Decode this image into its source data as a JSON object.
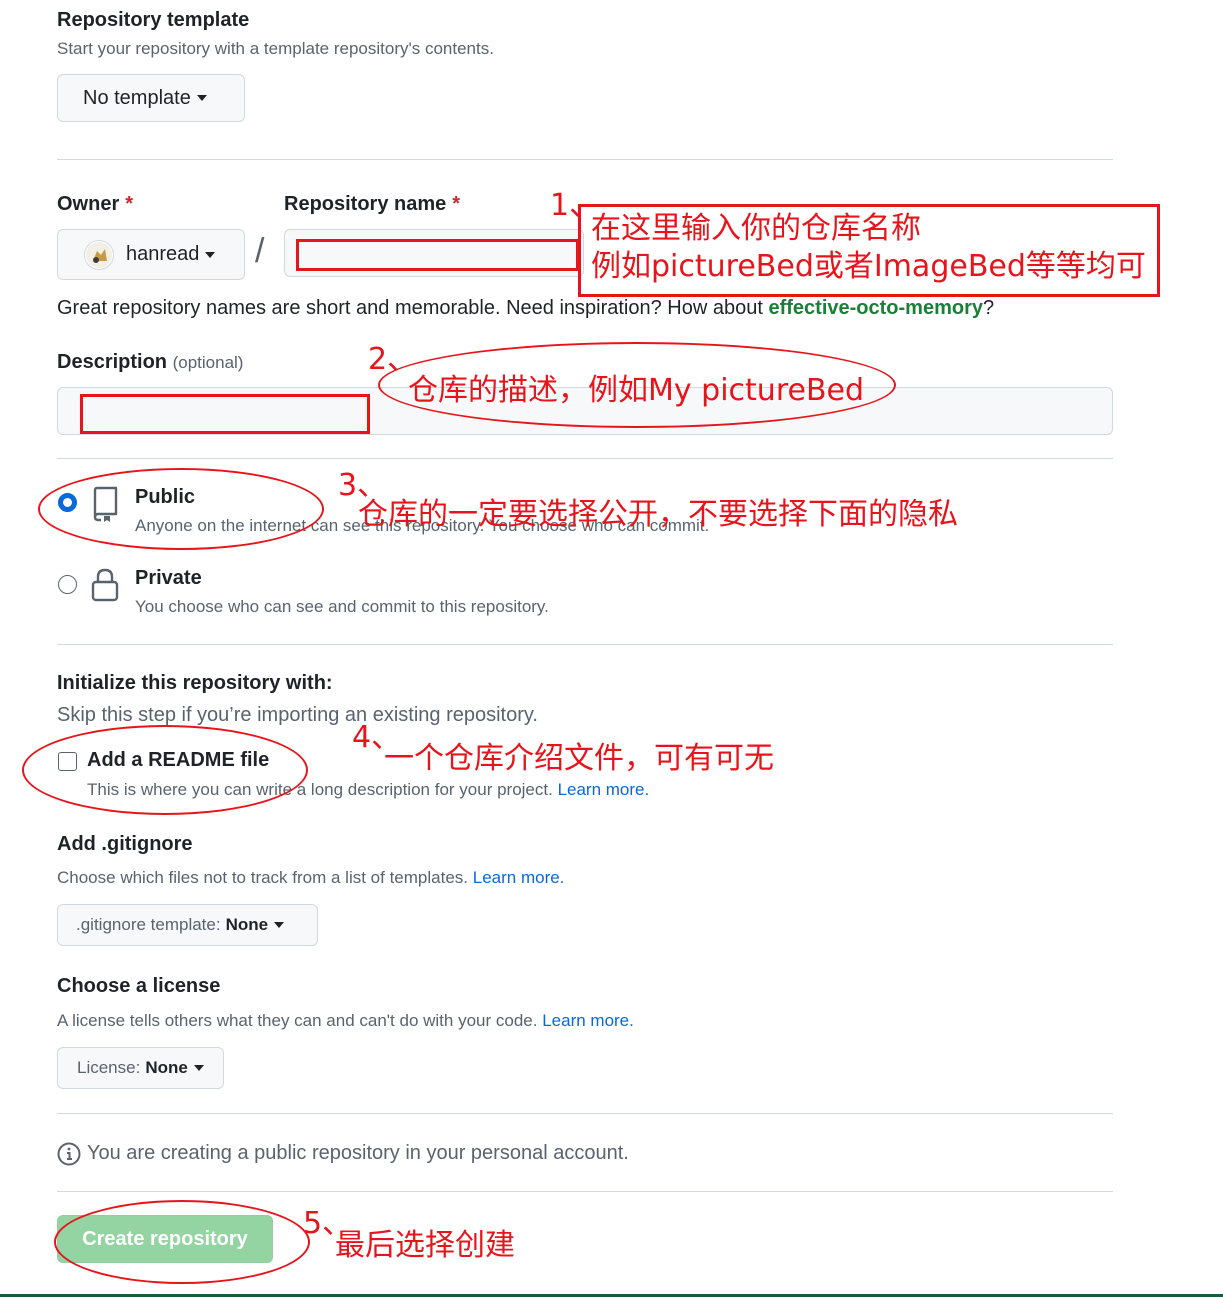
{
  "template_section": {
    "title": "Repository template",
    "subtitle": "Start your repository with a template repository's contents.",
    "button_label": "No template"
  },
  "owner": {
    "label": "Owner",
    "required_mark": "*",
    "value": "hanread"
  },
  "repo_name": {
    "label": "Repository name",
    "required_mark": "*",
    "value": "",
    "separator": "/"
  },
  "name_hint": {
    "text": "Great repository names are short and memorable. Need inspiration? How about ",
    "suggestion": "effective-octo-memory",
    "suffix": "?"
  },
  "description": {
    "label": "Description",
    "optional": "(optional)",
    "value": ""
  },
  "visibility": {
    "public": {
      "title": "Public",
      "desc": "Anyone on the internet can see this repository. You choose who can commit.",
      "checked": true
    },
    "private": {
      "title": "Private",
      "desc": "You choose who can see and commit to this repository.",
      "checked": false
    }
  },
  "init": {
    "title": "Initialize this repository with:",
    "subtitle": "Skip this step if you’re importing an existing repository.",
    "readme_label": "Add a README file",
    "readme_desc": "This is where you can write a long description for your project.",
    "learn_more": "Learn more."
  },
  "gitignore": {
    "title": "Add .gitignore",
    "desc": "Choose which files not to track from a list of templates.",
    "learn_more": "Learn more.",
    "button_prefix": ".gitignore template:",
    "button_value": "None"
  },
  "license": {
    "title": "Choose a license",
    "desc": "A license tells others what they can and can't do with your code.",
    "learn_more": "Learn more.",
    "button_prefix": "License:",
    "button_value": "None"
  },
  "notice": {
    "text": "You are creating a public repository in your personal account."
  },
  "submit": {
    "label": "Create repository"
  },
  "annotations": {
    "n1": "1、",
    "a1_line1": "在这里输入你的仓库名称",
    "a1_line2": "例如pictureBed或者ImageBed等等均可",
    "n2": "2、",
    "a2": "仓库的描述，例如My pictureBed",
    "n3": "3、",
    "a3": "仓库的一定要选择公开，不要选择下面的隐私",
    "n4": "4、",
    "a4": "一个仓库介绍文件，可有可无",
    "n5": "5、",
    "a5": "最后选择创建"
  },
  "colors": {
    "accent": "#0969da",
    "annotation": "#e8141b",
    "create_button": "#94d3a2",
    "suggestion": "#1a7f37"
  }
}
